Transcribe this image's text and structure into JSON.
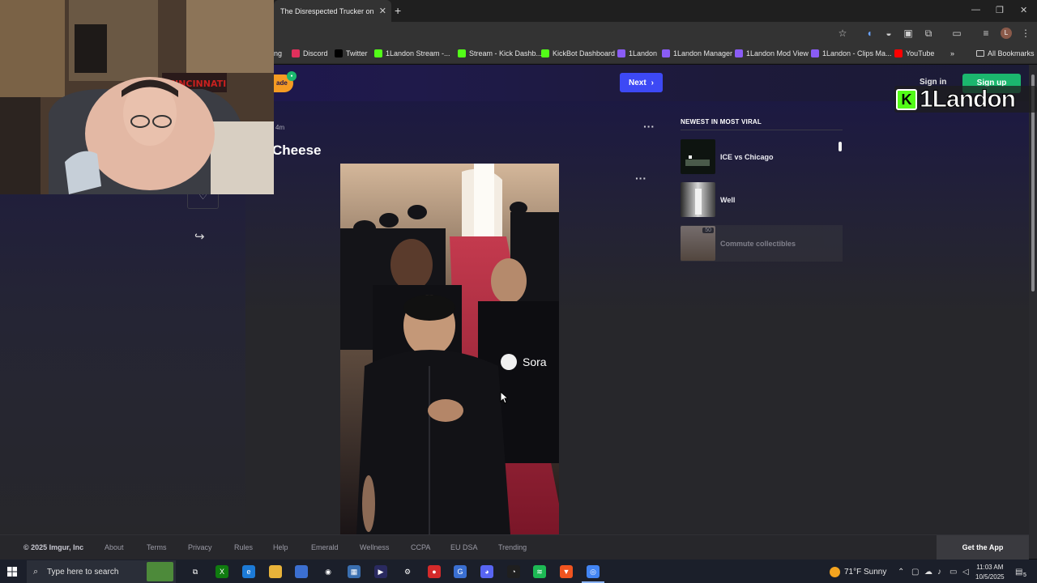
{
  "browser": {
    "tab_title": "The Disrespected Trucker on X",
    "tab_close": "✕",
    "new_tab": "+",
    "bookmarks": [
      {
        "label": "ng",
        "icon_color": "#444"
      },
      {
        "label": "Discord",
        "icon_color": "#e0305c"
      },
      {
        "label": "Twitter",
        "icon_color": "#000000"
      },
      {
        "label": "1Landon Stream -...",
        "icon_color": "#53fc18"
      },
      {
        "label": "Stream - Kick Dashb...",
        "icon_color": "#53fc18"
      },
      {
        "label": "KickBot Dashboard",
        "icon_color": "#53fc18"
      },
      {
        "label": "1Landon",
        "icon_color": "#8a5cf5"
      },
      {
        "label": "1Landon Manager",
        "icon_color": "#8a5cf5"
      },
      {
        "label": "1Landon Mod View",
        "icon_color": "#8a5cf5"
      },
      {
        "label": "1Landon - Clips Ma...",
        "icon_color": "#8a5cf5"
      },
      {
        "label": "YouTube",
        "icon_color": "#ff0000"
      }
    ],
    "more_bookmarks": "»",
    "all_bookmarks": "All Bookmarks"
  },
  "header": {
    "badge_text": "ade",
    "next_label": "Next",
    "sign_in": "Sign in",
    "sign_up": "Sign up"
  },
  "post": {
    "time_ago": "4m",
    "title": "Cheese",
    "more": "···",
    "watermark": "Sora"
  },
  "sidebar": {
    "heading": "NEWEST IN MOST VIRAL",
    "items": [
      {
        "label": "ICE vs Chicago"
      },
      {
        "label": "Well"
      },
      {
        "label": "Commute collectibles",
        "count": "50"
      }
    ]
  },
  "overlay": {
    "kick_letter": "K",
    "channel_name": "1Landon"
  },
  "footer": {
    "copyright": "© 2025 Imgur, Inc",
    "links": [
      "About",
      "Terms",
      "Privacy",
      "Rules",
      "Help",
      "Emerald",
      "Wellness",
      "CCPA",
      "EU DSA",
      "Trending"
    ],
    "get_app": "Get the App"
  },
  "taskbar": {
    "search_placeholder": "Type here to search",
    "weather": "71°F  Sunny",
    "time": "11:03 AM",
    "date": "10/5/2025",
    "notification_count": "5"
  },
  "colors": {
    "next_button": "#3d49f5",
    "sign_up": "#1bb76e",
    "kick_green": "#53fc18",
    "header_bg": "#1d1350"
  }
}
